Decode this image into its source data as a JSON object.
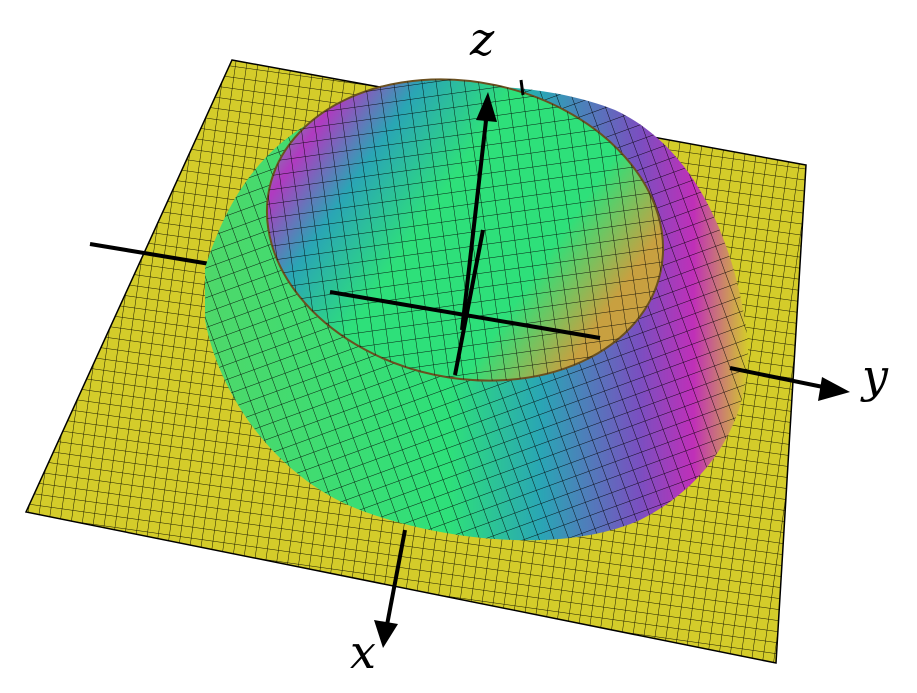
{
  "figure": {
    "description_type": "3d-surface-plot",
    "axes": {
      "x_label": "x",
      "y_label": "y",
      "z_label": "z"
    },
    "colors": {
      "flat_plane": "#d4cc2a",
      "mesh_lines": "#000000",
      "surface_low": "#d4cc2a",
      "surface_green": "#2ee07a",
      "surface_teal": "#2aa5b5",
      "surface_magenta": "#c02fb8",
      "axis": "#000000",
      "background": "#ffffff"
    }
  }
}
